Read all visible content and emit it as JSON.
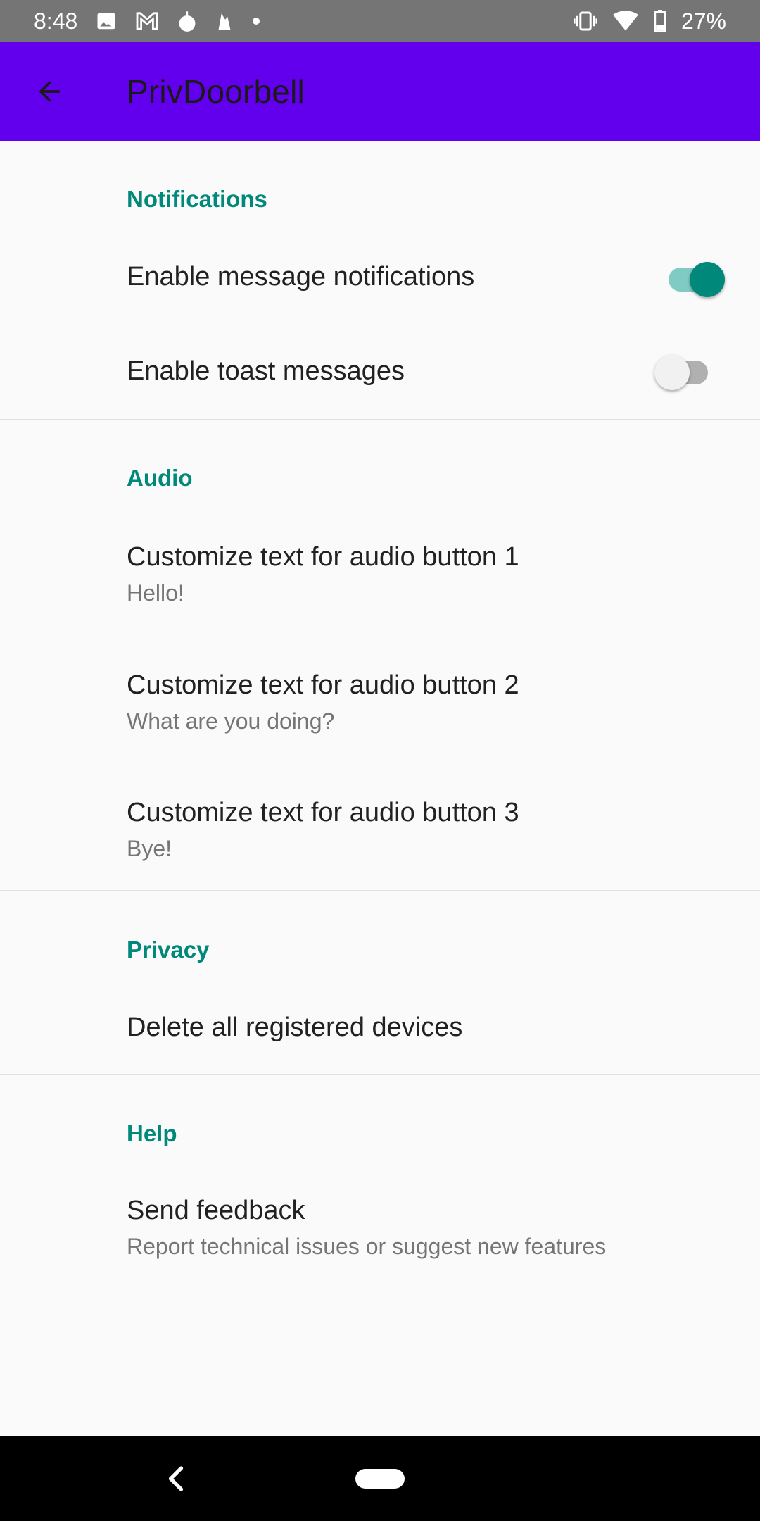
{
  "status_bar": {
    "time": "8:48",
    "battery": "27%",
    "icons": [
      "image-icon",
      "gmail-icon",
      "app-icon",
      "fire-icon",
      "dot-icon",
      "vibrate-icon",
      "wifi-icon",
      "battery-icon"
    ]
  },
  "app_bar": {
    "title": "PrivDoorbell",
    "color": "#6200ee"
  },
  "accent_color": "#00897b",
  "sections": {
    "notifications": {
      "header": "Notifications",
      "enable_message_notifications": {
        "title": "Enable message notifications",
        "checked": true
      },
      "enable_toast_messages": {
        "title": "Enable toast messages",
        "checked": false
      }
    },
    "audio": {
      "header": "Audio",
      "button1": {
        "title": "Customize text for audio button 1",
        "summary": "Hello!"
      },
      "button2": {
        "title": "Customize text for audio button 2",
        "summary": "What are you doing?"
      },
      "button3": {
        "title": "Customize text for audio button 3",
        "summary": "Bye!"
      }
    },
    "privacy": {
      "header": "Privacy",
      "delete_devices": {
        "title": "Delete all registered devices"
      }
    },
    "help": {
      "header": "Help",
      "send_feedback": {
        "title": "Send feedback",
        "summary": "Report technical issues or suggest new features"
      }
    }
  }
}
